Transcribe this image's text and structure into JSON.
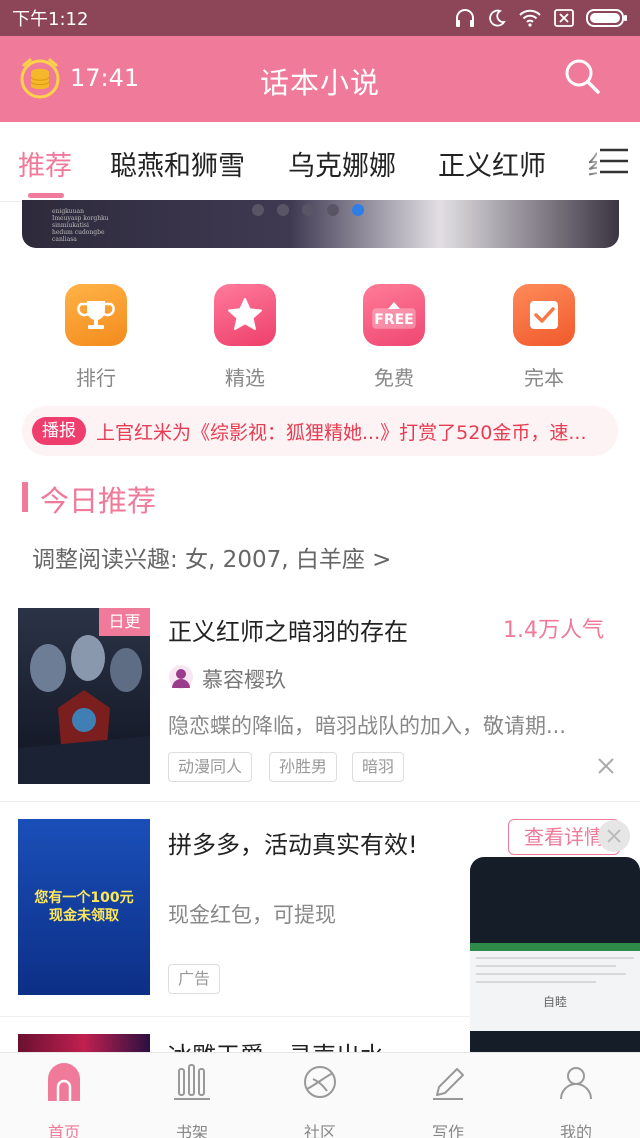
{
  "status_bar": {
    "time": "下午1:12"
  },
  "header": {
    "clock": "17:41",
    "title": "话本小说"
  },
  "tabs": [
    {
      "label": "推荐"
    },
    {
      "label": "聪燕和狮雪"
    },
    {
      "label": "乌克娜娜"
    },
    {
      "label": "正义红师"
    }
  ],
  "tab_overflow_glyph": "纟",
  "banner": {
    "text_lines": [
      "enigkuuan",
      "Imeuyasp korghku",
      "sinmiukatisi",
      "hedum cudongbe",
      "canliasa"
    ],
    "dot_count": 5,
    "active_dot": 4
  },
  "categories": [
    {
      "label": "排行",
      "icon": "trophy-icon",
      "color": "#f6a02a"
    },
    {
      "label": "精选",
      "icon": "star-icon",
      "color": "#f2567e"
    },
    {
      "label": "免费",
      "icon": "free-icon",
      "color": "#f3577b"
    },
    {
      "label": "完本",
      "icon": "checklist-icon",
      "color": "#f36a3b"
    }
  ],
  "broadcast": {
    "tag": "播报",
    "message": "上官红米为《综影视：狐狸精她...》打赏了520金币，速..."
  },
  "section": {
    "title": "今日推荐",
    "interest": "调整阅读兴趣: 女, 2007, 白羊座 >"
  },
  "books": [
    {
      "title": "正义红师之暗羽的存在",
      "popularity": "1.4万人气",
      "author": "慕容樱玖",
      "description": "隐恋蝶的降临，暗羽战队的加入，敬请期...",
      "badge": "日更",
      "tags": [
        "动漫同人",
        "孙胜男",
        "暗羽"
      ]
    }
  ],
  "ad": {
    "title": "拼多多，活动真实有效!",
    "subtitle": "现金红包，可提现",
    "button": "查看详情",
    "tag": "广告",
    "cover_line1": "您有一个100元",
    "cover_line2": "现金未领取"
  },
  "partial_book_title": "冰雕王爵，寻声出水",
  "floating_video": {
    "caption": "自睦"
  },
  "bottom_nav": [
    {
      "label": "首页",
      "icon": "home-icon",
      "active": true
    },
    {
      "label": "书架",
      "icon": "bookshelf-icon",
      "active": false
    },
    {
      "label": "社区",
      "icon": "planet-icon",
      "active": false
    },
    {
      "label": "写作",
      "icon": "pen-icon",
      "active": false
    },
    {
      "label": "我的",
      "icon": "profile-icon",
      "active": false
    }
  ],
  "colors": {
    "accent": "#f07a9a",
    "header": "#f07a9a",
    "status_bar": "#8c4658",
    "broadcast_text": "#e63d52"
  }
}
